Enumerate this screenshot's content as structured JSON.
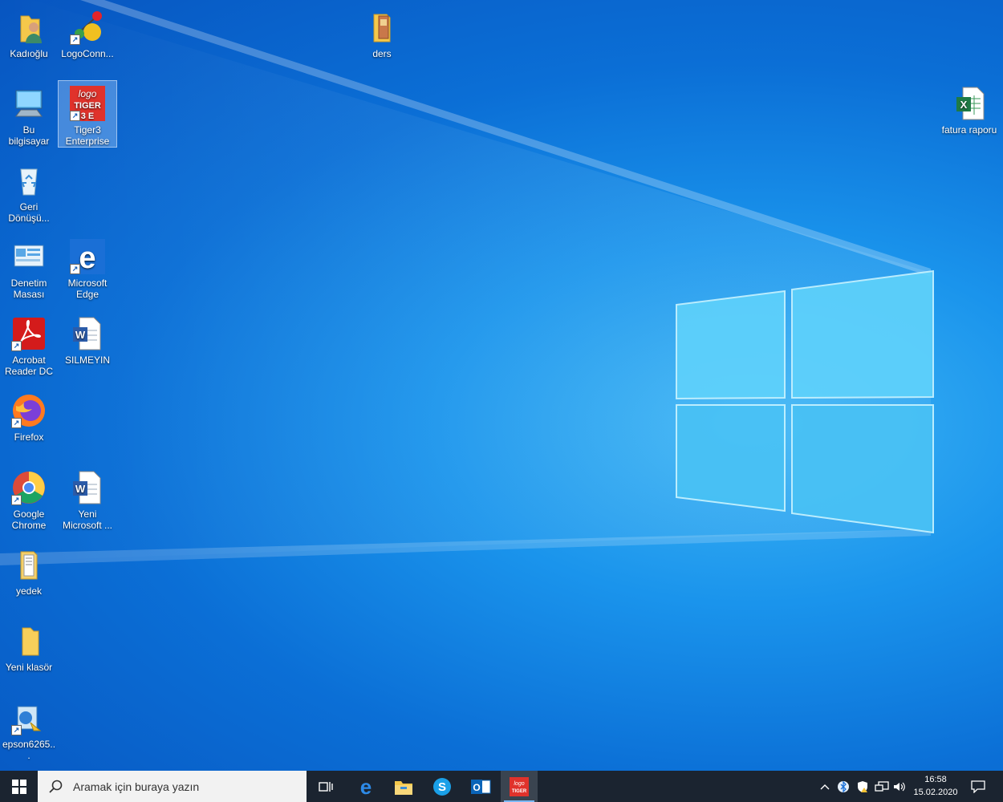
{
  "desktop": {
    "icons": [
      {
        "label": "Kadıoğlu",
        "icon": "user-folder-icon"
      },
      {
        "label": "LogoConn...",
        "icon": "logoconnect-icon"
      },
      {
        "label": "ders",
        "icon": "folder-icon"
      },
      {
        "label": "Bu bilgisayar",
        "icon": "computer-icon"
      },
      {
        "label": "Tiger3 Enterprise",
        "icon": "logo-tiger-icon"
      },
      {
        "label": "fatura raporu",
        "icon": "excel-file-icon"
      },
      {
        "label": "Geri Dönüşü...",
        "icon": "recycle-bin-icon"
      },
      {
        "label": "Denetim Masası",
        "icon": "control-panel-icon"
      },
      {
        "label": "Microsoft Edge",
        "icon": "edge-icon"
      },
      {
        "label": "Acrobat Reader DC",
        "icon": "acrobat-icon"
      },
      {
        "label": "SILMEYIN",
        "icon": "word-file-icon"
      },
      {
        "label": "Firefox",
        "icon": "firefox-icon"
      },
      {
        "label": "Google Chrome",
        "icon": "chrome-icon"
      },
      {
        "label": "Yeni Microsoft ...",
        "icon": "word-file-icon"
      },
      {
        "label": "yedek",
        "icon": "folder-icon"
      },
      {
        "label": "Yeni klasör",
        "icon": "folder-icon"
      },
      {
        "label": "epson6265...",
        "icon": "installer-icon"
      }
    ]
  },
  "taskbar": {
    "search_placeholder": "Aramak için buraya yazın",
    "apps": [
      "task-view-icon",
      "edge-icon",
      "file-explorer-icon",
      "skype-icon",
      "outlook-icon",
      "logo-tiger-icon"
    ],
    "tray_icons": [
      "chevron-up-icon",
      "bluetooth-icon",
      "defender-icon",
      "network-icon",
      "volume-icon"
    ],
    "time": "16:58",
    "date": "15.02.2020"
  },
  "colors": {
    "taskbar_bg": "#1b2430",
    "desktop_accent": "#1a94ec",
    "selection": "#b4d7ff"
  }
}
